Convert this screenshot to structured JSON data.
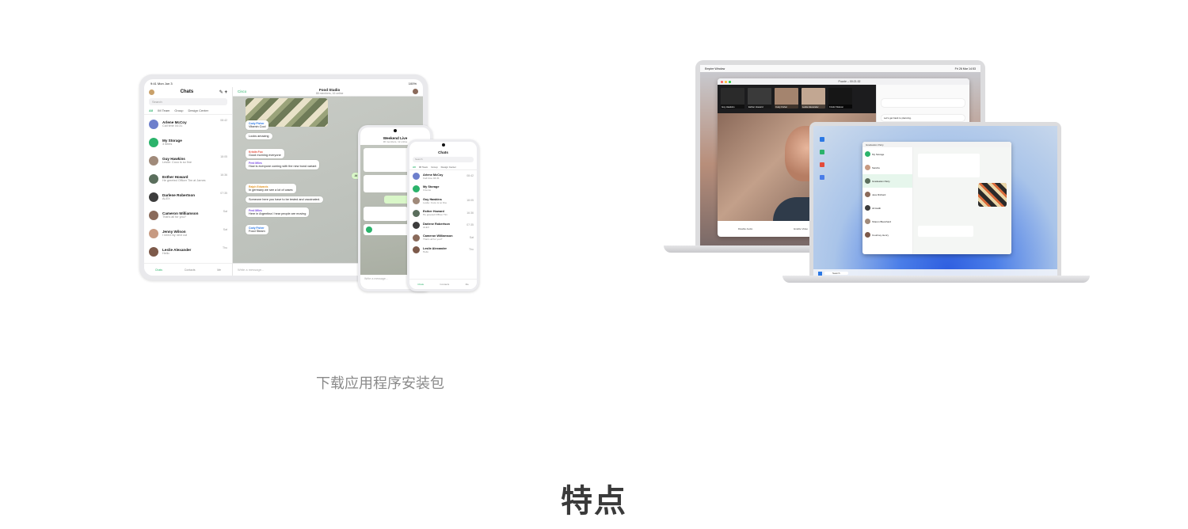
{
  "download_label": "下载应用程序安装包",
  "section_heading": "特点",
  "tablet": {
    "status_time": "9:41  Mon Jun 3",
    "status_right": "100%",
    "list_title": "Chats",
    "search_placeholder": "Search",
    "filters": [
      "All",
      "IM Team",
      "Group",
      "Design Center"
    ],
    "chats": [
      {
        "name": "Arlene McCoy",
        "msg": "Call time 04:31",
        "time": "08:42",
        "color": "#6d7fcc"
      },
      {
        "name": "My Storage",
        "msg": "3 items",
        "time": "",
        "color": "#2bb36b"
      },
      {
        "name": "Guy Hawkins",
        "msg": "Leslie: Coco is so fine",
        "time": "18:05",
        "color": "#a08a7a"
      },
      {
        "name": "Esther Howard",
        "msg": "He greeted Officer Tim at James",
        "time": "16:36",
        "color": "#5a6e5c"
      },
      {
        "name": "Darlene Robertson",
        "msg": "ALEX",
        "time": "07:35",
        "color": "#3c3c3c"
      },
      {
        "name": "Cameron Williamson",
        "msg": "That's all for you?",
        "time": "Sat",
        "color": "#8a6a5a"
      },
      {
        "name": "Jenny Wilson",
        "msg": "I need my next cut",
        "time": "Sat",
        "color": "#c79a82"
      },
      {
        "name": "Leslie Alexander",
        "msg": "Hello",
        "time": "Thu",
        "color": "#7d5a4a"
      }
    ],
    "tabs": [
      "Chats",
      "Contacts",
      "Me"
    ],
    "conversation_title": "Food Studio",
    "conversation_sub": "88 members, 16 online",
    "back_label": "Cisco",
    "messages": [
      {
        "who": "Cody Fisher",
        "text": "Vitamin Cool",
        "out": false
      },
      {
        "who": "",
        "text": "Looks amazing",
        "out": false
      },
      {
        "who": "Kristin Fox",
        "text": "Good morning everyone",
        "out": false
      },
      {
        "who": "Fred Miles",
        "text": "How is everyone coming with the new bond variant",
        "out": false
      },
      {
        "who": "",
        "text": "At the moment in Italy we have only one case",
        "out": true
      },
      {
        "who": "Ralph Edwards",
        "text": "In germany we see a lot of cases",
        "out": false
      },
      {
        "who": "",
        "text": "Someone here you have to be tested and vaccinated.",
        "out": false
      },
      {
        "who": "Fred Miles",
        "text": "Here in Argentina I hear people are moving",
        "out": false
      },
      {
        "who": "Cody Fisher",
        "text": "Food Steam",
        "out": false
      }
    ],
    "input_placeholder": "Write a message..."
  },
  "phone_chat": {
    "title": "Weekend Live",
    "sub": "36 members, 12 online",
    "input_placeholder": "Write a message..."
  },
  "phone_list": {
    "title": "Chats",
    "search_placeholder": "Search",
    "filters": [
      "All",
      "IM Team",
      "Group",
      "Design Center"
    ],
    "chats": [
      {
        "name": "Arlene McCoy",
        "msg": "Call time 04:31",
        "time": "08:42",
        "color": "#6d7fcc"
      },
      {
        "name": "My Storage",
        "msg": "3 items",
        "time": "",
        "color": "#2bb36b"
      },
      {
        "name": "Guy Hawkins",
        "msg": "Leslie: Coco is so fine",
        "time": "18:05",
        "color": "#a08a7a"
      },
      {
        "name": "Esther Howard",
        "msg": "He greeted Officer Tim",
        "time": "16:36",
        "color": "#5a6e5c"
      },
      {
        "name": "Darlene Robertson",
        "msg": "ALEX",
        "time": "07:35",
        "color": "#3c3c3c"
      },
      {
        "name": "Cameron Williamson",
        "msg": "That's all for you?",
        "time": "Sat",
        "color": "#8a6a5a"
      },
      {
        "name": "Leslie Alexander",
        "msg": "Hello",
        "time": "Thu",
        "color": "#7d5a4a"
      }
    ],
    "tabs": [
      "Chats",
      "Contacts",
      "Me"
    ]
  },
  "mac": {
    "menu_left": "Empire   Window",
    "menu_right": "Fri 26 Mar 14:53",
    "window_title": "Empire",
    "call_title": "Puzzle – 00:21:32",
    "call_tiles": [
      "Guy Hawkins",
      "Esther Howard",
      "Cody Fisher",
      "Leslie Alexander",
      "Kristin Watson"
    ],
    "controls": [
      "Disable Audio",
      "Enable Video",
      "Share"
    ],
    "chat_text": "Let's get back to planning."
  },
  "windows": {
    "chat_title": "Graduation Party",
    "taskbar_search": "Search",
    "list": [
      "My Storage",
      "Sandra",
      "Graduation Party",
      "Jess Richard",
      "Ali Hatib",
      "Sharon Blanchard",
      "Courtney Henry"
    ]
  }
}
